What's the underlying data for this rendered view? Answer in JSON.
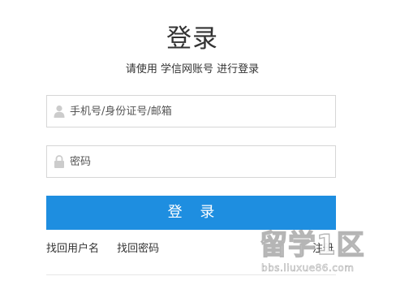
{
  "title": "登录",
  "subtitle": "请使用 学信网账号 进行登录",
  "username": {
    "placeholder": "手机号/身份证号/邮箱",
    "value": "",
    "icon": "user-icon"
  },
  "password": {
    "placeholder": "密码",
    "value": "",
    "icon": "lock-icon"
  },
  "login_button_label": "登 录",
  "links": {
    "retrieve_username": "找回用户名",
    "retrieve_password": "找回密码",
    "register": "注册"
  },
  "watermark": {
    "brand": "留学1区",
    "url": "bbs.liuxue86.com"
  },
  "colors": {
    "primary": "#1e8ee0",
    "text": "#333333",
    "border": "#d6d6d6",
    "icon": "#cccccc"
  }
}
